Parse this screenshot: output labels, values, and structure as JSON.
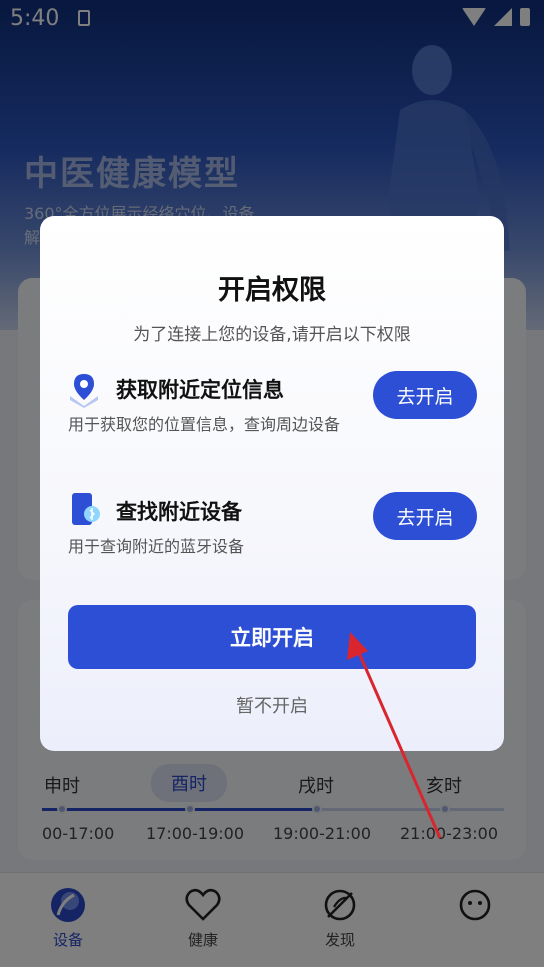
{
  "status_bar": {
    "time": "5:40"
  },
  "hero": {
    "title": "中医健康模型",
    "description_line1": "360°全方位展示经络穴位、设备",
    "description_line2": "解"
  },
  "shichen": {
    "items": [
      {
        "label": "申时",
        "time": "00-17:00",
        "active": false
      },
      {
        "label": "酉时",
        "time": "17:00-19:00",
        "active": true
      },
      {
        "label": "戌时",
        "time": "19:00-21:00",
        "active": false
      },
      {
        "label": "亥时",
        "time": "21:00-23:00",
        "active": false
      }
    ]
  },
  "tabbar": {
    "items": [
      {
        "label": "设备",
        "icon": "device-icon",
        "active": true
      },
      {
        "label": "健康",
        "icon": "heart-icon",
        "active": false
      },
      {
        "label": "发现",
        "icon": "compass-icon",
        "active": false
      },
      {
        "label": "",
        "icon": "smile-icon",
        "active": false
      }
    ]
  },
  "dialog": {
    "title": "开启权限",
    "subtitle": "为了连接上您的设备,请开启以下权限",
    "permissions": [
      {
        "icon": "location-pin-icon",
        "title": "获取附近定位信息",
        "description": "用于获取您的位置信息，查询周边设备",
        "button": "去开启"
      },
      {
        "icon": "bluetooth-phone-icon",
        "title": "查找附近设备",
        "description": "用于查询附近的蓝牙设备",
        "button": "去开启"
      }
    ],
    "primary_button": "立即开启",
    "secondary_link": "暂不开启"
  },
  "colors": {
    "accent": "#2d4fd6",
    "hero_top": "#0f2f7d",
    "annotation_arrow": "#d9252e"
  }
}
